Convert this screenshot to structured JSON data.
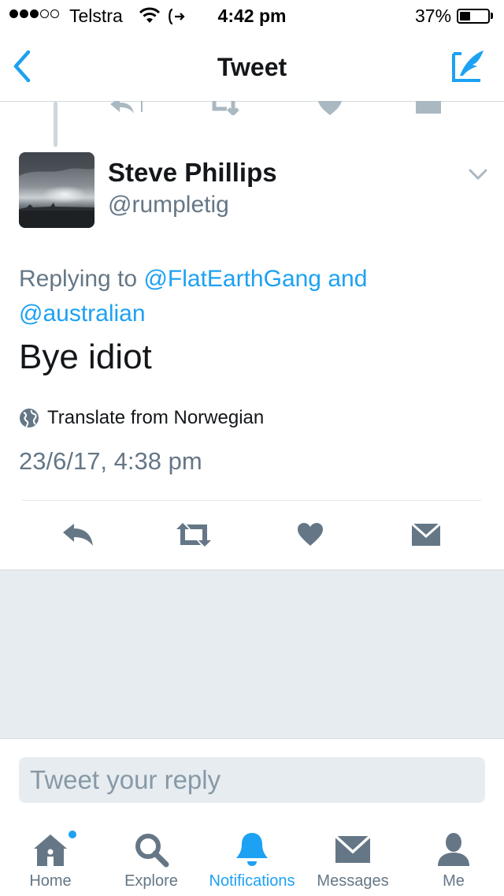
{
  "status_bar": {
    "carrier": "Telstra",
    "signal_bars_filled": 3,
    "signal_bars_total": 5,
    "time": "4:42 pm",
    "battery_percent": "37%",
    "battery_level": 0.37
  },
  "nav": {
    "title": "Tweet"
  },
  "tweet": {
    "author_name": "Steve Phillips",
    "author_handle": "@rumpletig",
    "replying_prefix": "Replying to ",
    "replying_mention_1": "@FlatEarthGang",
    "replying_and": " and",
    "replying_mention_2": "@australian",
    "text": "Bye idiot",
    "translate_label": "Translate from Norwegian",
    "timestamp": "23/6/17, 4:38 pm"
  },
  "reply_box": {
    "placeholder": "Tweet your reply"
  },
  "tab_bar": {
    "items": [
      {
        "label": "Home",
        "icon": "home-icon",
        "active": false
      },
      {
        "label": "Explore",
        "icon": "search-icon",
        "active": false
      },
      {
        "label": "Notifications",
        "icon": "bell-icon",
        "active": true
      },
      {
        "label": "Messages",
        "icon": "envelope-icon",
        "active": false
      },
      {
        "label": "Me",
        "icon": "person-icon",
        "active": false
      }
    ]
  },
  "colors": {
    "accent": "#1da1f2",
    "secondary_text": "#657786",
    "background_gray": "#e6ecf0"
  }
}
